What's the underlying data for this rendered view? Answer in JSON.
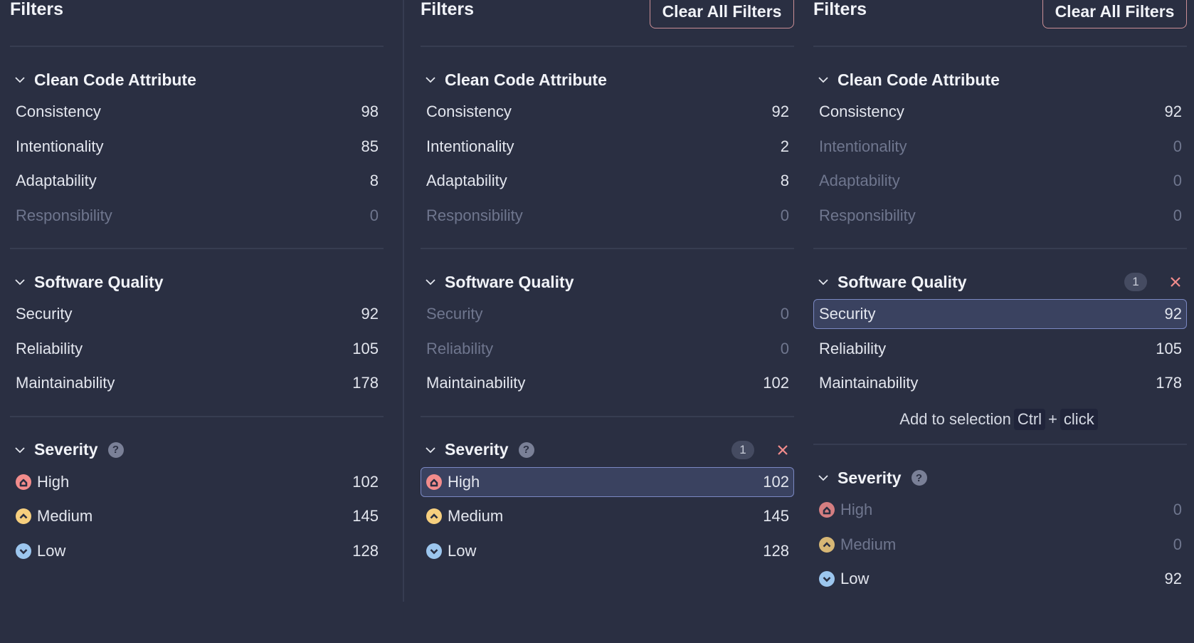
{
  "colors": {
    "background": "#2a2f42",
    "selected_bg": "#3a4260",
    "selected_border": "#7b88c2",
    "clear_button_border": "#c98e95",
    "high": "#f28c8c",
    "medium": "#f6cf7e",
    "low": "#9cc6ee",
    "close_x": "#f28c8c"
  },
  "panels": [
    {
      "title": "Filters",
      "clear_all": "",
      "clean_code": {
        "title": "Clean Code Attribute",
        "items": [
          {
            "label": "Consistency",
            "count": "98"
          },
          {
            "label": "Intentionality",
            "count": "85"
          },
          {
            "label": "Adaptability",
            "count": "8"
          },
          {
            "label": "Responsibility",
            "count": "0"
          }
        ]
      },
      "software_quality": {
        "title": "Software Quality",
        "items": [
          {
            "label": "Security",
            "count": "92"
          },
          {
            "label": "Reliability",
            "count": "105"
          },
          {
            "label": "Maintainability",
            "count": "178"
          }
        ]
      },
      "severity": {
        "title": "Severity",
        "help": "?",
        "items": [
          {
            "label": "High",
            "count": "102"
          },
          {
            "label": "Medium",
            "count": "145"
          },
          {
            "label": "Low",
            "count": "128"
          }
        ]
      }
    },
    {
      "title": "Filters",
      "clear_all": "Clear All Filters",
      "clean_code": {
        "title": "Clean Code Attribute",
        "items": [
          {
            "label": "Consistency",
            "count": "92"
          },
          {
            "label": "Intentionality",
            "count": "2"
          },
          {
            "label": "Adaptability",
            "count": "8"
          },
          {
            "label": "Responsibility",
            "count": "0"
          }
        ]
      },
      "software_quality": {
        "title": "Software Quality",
        "items": [
          {
            "label": "Security",
            "count": "0"
          },
          {
            "label": "Reliability",
            "count": "0"
          },
          {
            "label": "Maintainability",
            "count": "102"
          }
        ]
      },
      "severity": {
        "title": "Severity",
        "help": "?",
        "badge": "1",
        "items": [
          {
            "label": "High",
            "count": "102"
          },
          {
            "label": "Medium",
            "count": "145"
          },
          {
            "label": "Low",
            "count": "128"
          }
        ]
      }
    },
    {
      "title": "Filters",
      "clear_all": "Clear All Filters",
      "clean_code": {
        "title": "Clean Code Attribute",
        "items": [
          {
            "label": "Consistency",
            "count": "92"
          },
          {
            "label": "Intentionality",
            "count": "0"
          },
          {
            "label": "Adaptability",
            "count": "0"
          },
          {
            "label": "Responsibility",
            "count": "0"
          }
        ]
      },
      "software_quality": {
        "title": "Software Quality",
        "badge": "1",
        "items": [
          {
            "label": "Security",
            "count": "92"
          },
          {
            "label": "Reliability",
            "count": "105"
          },
          {
            "label": "Maintainability",
            "count": "178"
          }
        ]
      },
      "hint": {
        "text": "Add to selection",
        "key": "Ctrl",
        "plus": "+",
        "action": "click"
      },
      "severity": {
        "title": "Severity",
        "help": "?",
        "items": [
          {
            "label": "High",
            "count": "0"
          },
          {
            "label": "Medium",
            "count": "0"
          },
          {
            "label": "Low",
            "count": "92"
          }
        ]
      }
    }
  ]
}
